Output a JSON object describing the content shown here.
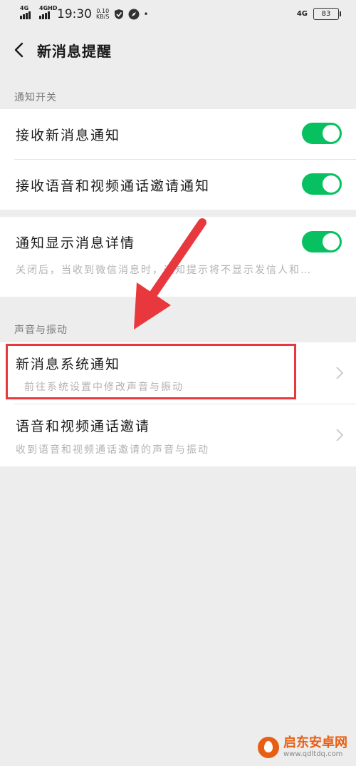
{
  "status_bar": {
    "signal1": "4G",
    "signal2": "4GHD",
    "time": "19:30",
    "speed_value": "0.10",
    "speed_unit": "KB/S",
    "network_right": "4G",
    "battery": "83"
  },
  "nav": {
    "title": "新消息提醒",
    "back_icon": "back-chevron-icon"
  },
  "sections": {
    "notify_switch_label": "通知开关",
    "sound_vibrate_label": "声音与振动"
  },
  "rows": {
    "receive_new_msg": {
      "title": "接收新消息通知",
      "enabled": true
    },
    "receive_call_invite": {
      "title": "接收语音和视频通话邀请通知",
      "enabled": true
    },
    "show_details": {
      "title": "通知显示消息详情",
      "subtitle": "关闭后，当收到微信消息时，通知提示将不显示发信人和…",
      "enabled": true
    },
    "system_notify": {
      "title": "新消息系统通知",
      "subtitle": "前往系统设置中修改声音与振动"
    },
    "call_invite_sound": {
      "title": "语音和视频通话邀请",
      "subtitle": "收到语音和视频通话邀请的声音与振动"
    }
  },
  "colors": {
    "toggle_on": "#07c160",
    "highlight": "#e8383d"
  },
  "watermark": {
    "name": "启东安卓网",
    "url": "www.qdltdq.com"
  }
}
